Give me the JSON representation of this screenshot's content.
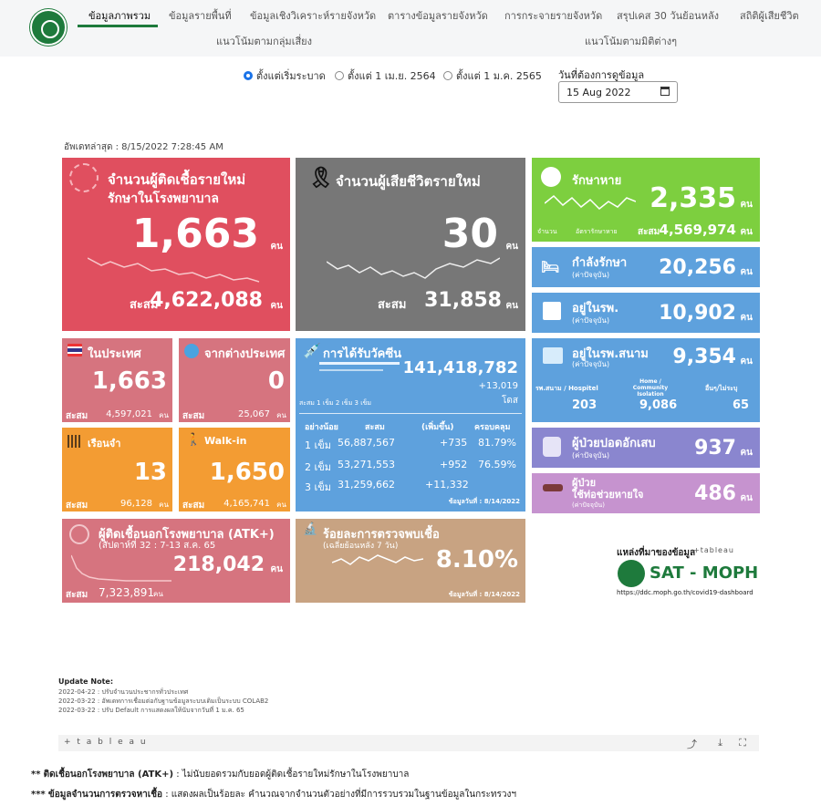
{
  "nav": {
    "items": [
      "ข้อมูลภาพรวม",
      "ข้อมูลรายพื้นที่",
      "ข้อมูลเชิงวิเคราะห์รายจังหวัด",
      "ตารางข้อมูลรายจังหวัด",
      "การกระจายรายจังหวัด",
      "สรุปเคส 30 วันย้อนหลัง",
      "สถิติผู้เสียชีวิต"
    ],
    "row2": [
      "แนวโน้มตามกลุ่มเสี่ยง",
      "แนวโน้มตามมิติต่างๆ"
    ]
  },
  "filter": {
    "options": [
      "ตั้งแต่เริ่มระบาด",
      "ตั้งแต่ 1 เม.ย. 2564",
      "ตั้งแต่ 1 ม.ค. 2565"
    ],
    "selected": 0,
    "date_label": "วันที่ต้องการดูข้อมูล",
    "date_value": "15 Aug 2022"
  },
  "updated": "อัพเดทล่าสุด : 8/15/2022 7:28:45 AM",
  "unit": "คน",
  "cum_label": "สะสม",
  "new_cases": {
    "title1": "จำนวนผู้ติดเชื้อรายใหม่",
    "title2": "รักษาในโรงพยาบาล",
    "value": "1,663",
    "cum": "4,622,088"
  },
  "deaths": {
    "title": "จำนวนผู้เสียชีวิตรายใหม่",
    "value": "30",
    "cum": "31,858"
  },
  "recovered": {
    "title": "รักษาหาย",
    "value": "2,335",
    "cum": "4,569,974",
    "legend1": "จำนวน",
    "legend2": "อัตรารักษาหาย"
  },
  "treating": {
    "title": "กำลังรักษา",
    "sub": "(ค่าปัจจุบัน)",
    "value": "20,256"
  },
  "in_hosp": {
    "title": "อยู่ในรพ.",
    "sub": "(ค่าปัจจุบัน)",
    "value": "10,902"
  },
  "domestic": {
    "title": "ในประเทศ",
    "value": "1,663",
    "cum": "4,597,021"
  },
  "abroad": {
    "title": "จากต่างประเทศ",
    "value": "0",
    "cum": "25,067"
  },
  "prison": {
    "title": "เรือนจำ",
    "value": "13",
    "cum": "96,128"
  },
  "walkin": {
    "title": "Walk-in",
    "value": "1,650",
    "cum": "4,165,741"
  },
  "vaccine": {
    "title": "การได้รับวัคซีน",
    "total": "141,418,782",
    "delta": "+13,019",
    "dose_unit": "โดส",
    "legend": "สะสม  1 เข็ม  2 เข็ม  3 เข็ม",
    "headers": [
      "อย่างน้อย",
      "สะสม",
      "(เพิ่มขึ้น)",
      "ครอบคลุม"
    ],
    "rows": [
      [
        "1 เข็ม",
        "56,887,567",
        "+735",
        "81.79%"
      ],
      [
        "2 เข็ม",
        "53,271,553",
        "+952",
        "76.59%"
      ],
      [
        "3 เข็ม",
        "31,259,662",
        "+11,332",
        ""
      ]
    ],
    "date": "ข้อมูลวันที่ : 8/14/2022"
  },
  "field_hosp": {
    "title": "อยู่ในรพ.สนาม",
    "sub": "(ค่าปัจจุบัน)",
    "value": "9,354",
    "cols": [
      {
        "label": "รพ.สนาม / Hospitel",
        "value": "203"
      },
      {
        "label": "Home / Community Isolation",
        "value": "9,086"
      },
      {
        "label": "อื่นๆ/ไม่ระบุ",
        "value": "65"
      }
    ]
  },
  "pneumonia": {
    "title": "ผู้ป่วยปอดอักเสบ",
    "sub": "(ค่าปัจจุบัน)",
    "value": "937"
  },
  "ventilator": {
    "title1": "ผู้ป่วย",
    "title2": "ใช้ท่อช่วยหายใจ",
    "sub": "(ค่าปัจจุบัน)",
    "value": "486"
  },
  "atk": {
    "title": "ผู้ติดเชื้อนอกโรงพยาบาล (ATK+)",
    "sub": "(สัปดาห์ที่  32 : 7-13 ส.ค. 65",
    "value": "218,042",
    "cum": "7,323,891"
  },
  "positivity": {
    "title": "ร้อยละการตรวจพบเชื้อ",
    "sub": "(เฉลี่ยย้อนหลัง 7 วัน)",
    "value": "8.10%",
    "date": "ข้อมูลวันที่ : 8/14/2022"
  },
  "source": {
    "label": "แหล่งที่มาของข้อมูล",
    "tableau": "+tableau",
    "brand": "SAT - MOPH",
    "url": "https://ddc.moph.go.th/covid19-dashboard"
  },
  "update_note": {
    "title": "Update Note:",
    "lines": [
      "2022-04-22 : ปรับจำนวนประชากรทั่วประเทศ",
      "2022-03-22 : อัพเดทการเชื่อมต่อกับฐานข้อมูลระบบเดิมเป็นระบบ COLAB2",
      "2022-03-22 : ปรับ Default การแสดงผลให้นับจากวันที่ 1 ม.ค. 65"
    ]
  },
  "toolbar": {
    "brand": "+ t a b l e a u"
  },
  "notes": [
    {
      "mark": "**",
      "bold": "ติดเชื้อนอกโรงพยาบาล (ATK+)",
      "text": " : ไม่นับยอดรวมกับยอดผู้ติดเชื้อรายใหม่รักษาในโรงพยาบาล"
    },
    {
      "mark": "***",
      "bold": "ข้อมูลจำนวนการตรวจหาเชื้อ",
      "text": " : แสดงผลเป็นร้อยละ คำนวณจากจำนวนตัวอย่างที่มีการรวบรวมในฐานข้อมูลในกระทรวงฯ"
    }
  ],
  "colors": {
    "red": "#e04f5f",
    "gray": "#777777",
    "green": "#7dcf3f",
    "blue": "#5ea1dd",
    "pink": "#d6747f",
    "orange": "#f39c33",
    "purple": "#8a86cf",
    "violet": "#c693cf",
    "tan": "#c8a382"
  }
}
